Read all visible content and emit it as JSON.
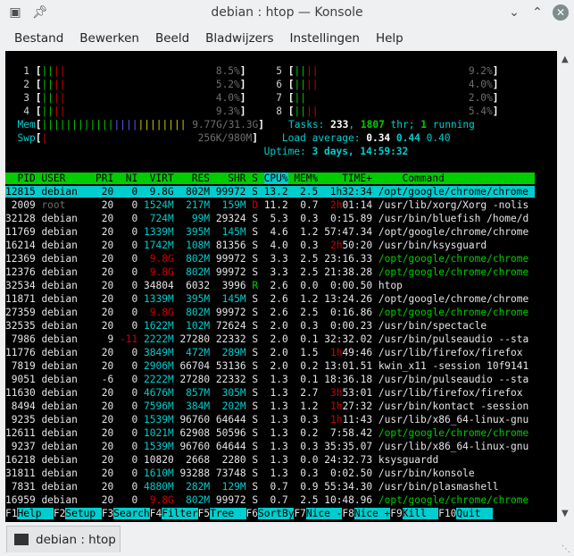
{
  "window": {
    "title": "debian : htop — Konsole",
    "icons": [
      "terminal-icon",
      "pin-icon",
      "chevron-down-icon",
      "chevron-up-icon",
      "close-icon"
    ]
  },
  "menubar": [
    "Bestand",
    "Bewerken",
    "Beeld",
    "Bladwijzers",
    "Instellingen",
    "Help"
  ],
  "tab": {
    "label": "debian : htop"
  },
  "meters": {
    "cpu_left": [
      {
        "id": "1",
        "pct": "8.5%"
      },
      {
        "id": "2",
        "pct": "5.2%"
      },
      {
        "id": "3",
        "pct": "4.0%"
      },
      {
        "id": "4",
        "pct": "9.3%"
      }
    ],
    "cpu_right": [
      {
        "id": "5",
        "pct": "9.2%"
      },
      {
        "id": "6",
        "pct": "4.0%"
      },
      {
        "id": "7",
        "pct": "2.0%"
      },
      {
        "id": "8",
        "pct": "5.4%"
      }
    ],
    "mem": {
      "label": "Mem",
      "value": "9.77G/31.3G"
    },
    "swp": {
      "label": "Swp",
      "value": "256K/980M"
    },
    "tasks": {
      "label": "Tasks: ",
      "tasks": "233",
      "thr": "1807",
      "thr_label": " thr; ",
      "running": "1",
      "running_label": " running"
    },
    "load": {
      "label": "Load average: ",
      "l1": "0.34",
      "l5": "0.44",
      "l15": "0.40"
    },
    "uptime": {
      "label": "Uptime: ",
      "value": "3 days, 14:59:32"
    }
  },
  "columns": [
    "PID",
    "USER",
    "PRI",
    "NI",
    "VIRT",
    "RES",
    "SHR",
    "S",
    "CPU%",
    "MEM%",
    "TIME+",
    "Command"
  ],
  "processes": [
    {
      "pid": "12815",
      "user": "debian",
      "pri": "20",
      "ni": "0",
      "virt": "9.8G",
      "res": "802M",
      "shr": "99972",
      "s": "S",
      "cpu": "13.2",
      "mem": "2.5",
      "time": "1h32:34",
      "cmd": "/opt/google/chrome/chrome"
    },
    {
      "pid": "2009",
      "user": "root",
      "pri": "20",
      "ni": "0",
      "virt": "1524M",
      "res": "217M",
      "shr": "159M",
      "s": "D",
      "cpu": "11.2",
      "mem": "0.7",
      "time": "2h01:14",
      "cmd": "/usr/lib/xorg/Xorg -nolis"
    },
    {
      "pid": "32128",
      "user": "debian",
      "pri": "20",
      "ni": "0",
      "virt": "724M",
      "res": "99M",
      "shr": "29324",
      "s": "S",
      "cpu": "5.3",
      "mem": "0.3",
      "time": "0:15.89",
      "cmd": "/usr/bin/bluefish /home/d"
    },
    {
      "pid": "11769",
      "user": "debian",
      "pri": "20",
      "ni": "0",
      "virt": "1339M",
      "res": "395M",
      "shr": "145M",
      "s": "S",
      "cpu": "4.6",
      "mem": "1.2",
      "time": "57:47.34",
      "cmd": "/opt/google/chrome/chrome"
    },
    {
      "pid": "16214",
      "user": "debian",
      "pri": "20",
      "ni": "0",
      "virt": "1742M",
      "res": "108M",
      "shr": "81356",
      "s": "S",
      "cpu": "4.0",
      "mem": "0.3",
      "time": "2h50:20",
      "cmd": "/usr/bin/ksysguard"
    },
    {
      "pid": "12369",
      "user": "debian",
      "pri": "20",
      "ni": "0",
      "virt": "9.8G",
      "res": "802M",
      "shr": "99972",
      "s": "S",
      "cpu": "3.3",
      "mem": "2.5",
      "time": "23:16.33",
      "cmd": "/opt/google/chrome/chrome"
    },
    {
      "pid": "12376",
      "user": "debian",
      "pri": "20",
      "ni": "0",
      "virt": "9.8G",
      "res": "802M",
      "shr": "99972",
      "s": "S",
      "cpu": "3.3",
      "mem": "2.5",
      "time": "21:38.28",
      "cmd": "/opt/google/chrome/chrome"
    },
    {
      "pid": "32534",
      "user": "debian",
      "pri": "20",
      "ni": "0",
      "virt": "34804",
      "res": "6032",
      "shr": "3996",
      "s": "R",
      "cpu": "2.6",
      "mem": "0.0",
      "time": "0:00.50",
      "cmd": "htop"
    },
    {
      "pid": "11871",
      "user": "debian",
      "pri": "20",
      "ni": "0",
      "virt": "1339M",
      "res": "395M",
      "shr": "145M",
      "s": "S",
      "cpu": "2.6",
      "mem": "1.2",
      "time": "13:24.26",
      "cmd": "/opt/google/chrome/chrome"
    },
    {
      "pid": "27359",
      "user": "debian",
      "pri": "20",
      "ni": "0",
      "virt": "9.8G",
      "res": "802M",
      "shr": "99972",
      "s": "S",
      "cpu": "2.6",
      "mem": "2.5",
      "time": "0:16.86",
      "cmd": "/opt/google/chrome/chrome"
    },
    {
      "pid": "32535",
      "user": "debian",
      "pri": "20",
      "ni": "0",
      "virt": "1622M",
      "res": "102M",
      "shr": "72624",
      "s": "S",
      "cpu": "2.0",
      "mem": "0.3",
      "time": "0:00.23",
      "cmd": "/usr/bin/spectacle"
    },
    {
      "pid": "7986",
      "user": "debian",
      "pri": "9",
      "ni": "-11",
      "virt": "2222M",
      "res": "27280",
      "shr": "22332",
      "s": "S",
      "cpu": "2.0",
      "mem": "0.1",
      "time": "32:32.02",
      "cmd": "/usr/bin/pulseaudio --sta"
    },
    {
      "pid": "11776",
      "user": "debian",
      "pri": "20",
      "ni": "0",
      "virt": "3849M",
      "res": "472M",
      "shr": "289M",
      "s": "S",
      "cpu": "2.0",
      "mem": "1.5",
      "time": "1h49:46",
      "cmd": "/usr/lib/firefox/firefox"
    },
    {
      "pid": "7819",
      "user": "debian",
      "pri": "20",
      "ni": "0",
      "virt": "2906M",
      "res": "66704",
      "shr": "53136",
      "s": "S",
      "cpu": "2.0",
      "mem": "0.2",
      "time": "13:01.51",
      "cmd": "kwin_x11 -session 10f9141"
    },
    {
      "pid": "9051",
      "user": "debian",
      "pri": "-6",
      "ni": "0",
      "virt": "2222M",
      "res": "27280",
      "shr": "22332",
      "s": "S",
      "cpu": "1.3",
      "mem": "0.1",
      "time": "18:36.18",
      "cmd": "/usr/bin/pulseaudio --sta"
    },
    {
      "pid": "11630",
      "user": "debian",
      "pri": "20",
      "ni": "0",
      "virt": "4676M",
      "res": "857M",
      "shr": "305M",
      "s": "S",
      "cpu": "1.3",
      "mem": "2.7",
      "time": "3h53:01",
      "cmd": "/usr/lib/firefox/firefox"
    },
    {
      "pid": "8494",
      "user": "debian",
      "pri": "20",
      "ni": "0",
      "virt": "7596M",
      "res": "384M",
      "shr": "202M",
      "s": "S",
      "cpu": "1.3",
      "mem": "1.2",
      "time": "1h27:32",
      "cmd": "/usr/bin/kontact -session"
    },
    {
      "pid": "9235",
      "user": "debian",
      "pri": "20",
      "ni": "0",
      "virt": "1539M",
      "res": "96760",
      "shr": "64644",
      "s": "S",
      "cpu": "1.3",
      "mem": "0.3",
      "time": "1h11:43",
      "cmd": "/usr/lib/x86_64-linux-gnu"
    },
    {
      "pid": "12611",
      "user": "debian",
      "pri": "20",
      "ni": "0",
      "virt": "1021M",
      "res": "62908",
      "shr": "50596",
      "s": "S",
      "cpu": "1.3",
      "mem": "0.2",
      "time": "7:58.42",
      "cmd": "/opt/google/chrome/chrome"
    },
    {
      "pid": "9237",
      "user": "debian",
      "pri": "20",
      "ni": "0",
      "virt": "1539M",
      "res": "96760",
      "shr": "64644",
      "s": "S",
      "cpu": "1.3",
      "mem": "0.3",
      "time": "35:35.07",
      "cmd": "/usr/lib/x86_64-linux-gnu"
    },
    {
      "pid": "16218",
      "user": "debian",
      "pri": "20",
      "ni": "0",
      "virt": "10820",
      "res": "2668",
      "shr": "2280",
      "s": "S",
      "cpu": "1.3",
      "mem": "0.0",
      "time": "24:32.73",
      "cmd": "ksysguardd"
    },
    {
      "pid": "31811",
      "user": "debian",
      "pri": "20",
      "ni": "0",
      "virt": "1610M",
      "res": "93288",
      "shr": "73748",
      "s": "S",
      "cpu": "1.3",
      "mem": "0.3",
      "time": "0:02.50",
      "cmd": "/usr/bin/konsole"
    },
    {
      "pid": "7831",
      "user": "debian",
      "pri": "20",
      "ni": "0",
      "virt": "4880M",
      "res": "282M",
      "shr": "129M",
      "s": "S",
      "cpu": "0.7",
      "mem": "0.9",
      "time": "55:34.30",
      "cmd": "/usr/bin/plasmashell"
    },
    {
      "pid": "16959",
      "user": "debian",
      "pri": "20",
      "ni": "0",
      "virt": "9.8G",
      "res": "802M",
      "shr": "99972",
      "s": "S",
      "cpu": "0.7",
      "mem": "2.5",
      "time": "10:48.96",
      "cmd": "/opt/google/chrome/chrome"
    }
  ],
  "fkeys": [
    {
      "key": "F1",
      "label": "Help  "
    },
    {
      "key": "F2",
      "label": "Setup "
    },
    {
      "key": "F3",
      "label": "Search"
    },
    {
      "key": "F4",
      "label": "Filter"
    },
    {
      "key": "F5",
      "label": "Tree  "
    },
    {
      "key": "F6",
      "label": "SortBy"
    },
    {
      "key": "F7",
      "label": "Nice -"
    },
    {
      "key": "F8",
      "label": "Nice +"
    },
    {
      "key": "F9",
      "label": "Kill  "
    },
    {
      "key": "F10",
      "label": "Quit  "
    }
  ],
  "colors": {
    "cyan": "#00cdcd",
    "green": "#00cd00",
    "red": "#cd0000",
    "terminal_bg": "#000000"
  }
}
